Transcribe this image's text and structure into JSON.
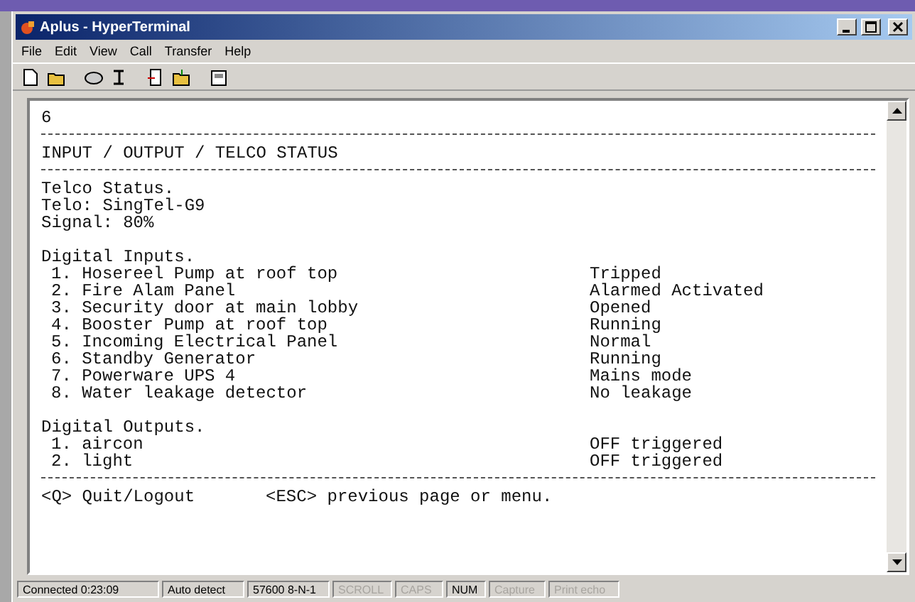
{
  "window": {
    "title": "Aplus - HyperTerminal"
  },
  "menu": [
    {
      "label": "File"
    },
    {
      "label": "Edit"
    },
    {
      "label": "View"
    },
    {
      "label": "Call"
    },
    {
      "label": "Transfer"
    },
    {
      "label": "Help"
    }
  ],
  "terminal": {
    "lines": [
      {
        "kind": "text",
        "text": "6"
      },
      {
        "kind": "rule"
      },
      {
        "kind": "text",
        "text": "INPUT / OUTPUT / TELCO STATUS"
      },
      {
        "kind": "rule"
      },
      {
        "kind": "text",
        "text": "Telco Status."
      },
      {
        "kind": "text",
        "text": "Telo: SingTel-G9"
      },
      {
        "kind": "text",
        "text": "Signal: 80%"
      },
      {
        "kind": "blank"
      },
      {
        "kind": "text",
        "text": "Digital Inputs."
      },
      {
        "kind": "item",
        "text": "1. Hosereel Pump at roof top",
        "status": "Tripped"
      },
      {
        "kind": "item",
        "text": "2. Fire Alam Panel",
        "status": "Alarmed Activated"
      },
      {
        "kind": "item",
        "text": "3. Security door at main lobby",
        "status": "Opened"
      },
      {
        "kind": "item",
        "text": "4. Booster Pump at roof top",
        "status": "Running"
      },
      {
        "kind": "item",
        "text": "5. Incoming Electrical Panel",
        "status": "Normal"
      },
      {
        "kind": "item",
        "text": "6. Standby Generator",
        "status": "Running"
      },
      {
        "kind": "item",
        "text": "7. Powerware UPS 4",
        "status": "Mains mode"
      },
      {
        "kind": "item",
        "text": "8. Water leakage detector",
        "status": "No leakage"
      },
      {
        "kind": "blank"
      },
      {
        "kind": "text",
        "text": "Digital Outputs."
      },
      {
        "kind": "item",
        "text": "1. aircon",
        "status": "OFF triggered"
      },
      {
        "kind": "item",
        "text": "2. light",
        "status": "OFF triggered"
      },
      {
        "kind": "rule"
      },
      {
        "kind": "keys",
        "text": "<Q> Quit/Logout",
        "status": "<ESC> previous page or menu."
      }
    ]
  },
  "status_bar": [
    {
      "label": "Connected 0:23:09",
      "enabled": true
    },
    {
      "label": "Auto detect",
      "enabled": true
    },
    {
      "label": "57600 8-N-1",
      "enabled": true
    },
    {
      "label": "SCROLL",
      "enabled": false
    },
    {
      "label": "CAPS",
      "enabled": false
    },
    {
      "label": "NUM",
      "enabled": true
    },
    {
      "label": "Capture",
      "enabled": false
    },
    {
      "label": "Print echo",
      "enabled": false
    }
  ]
}
